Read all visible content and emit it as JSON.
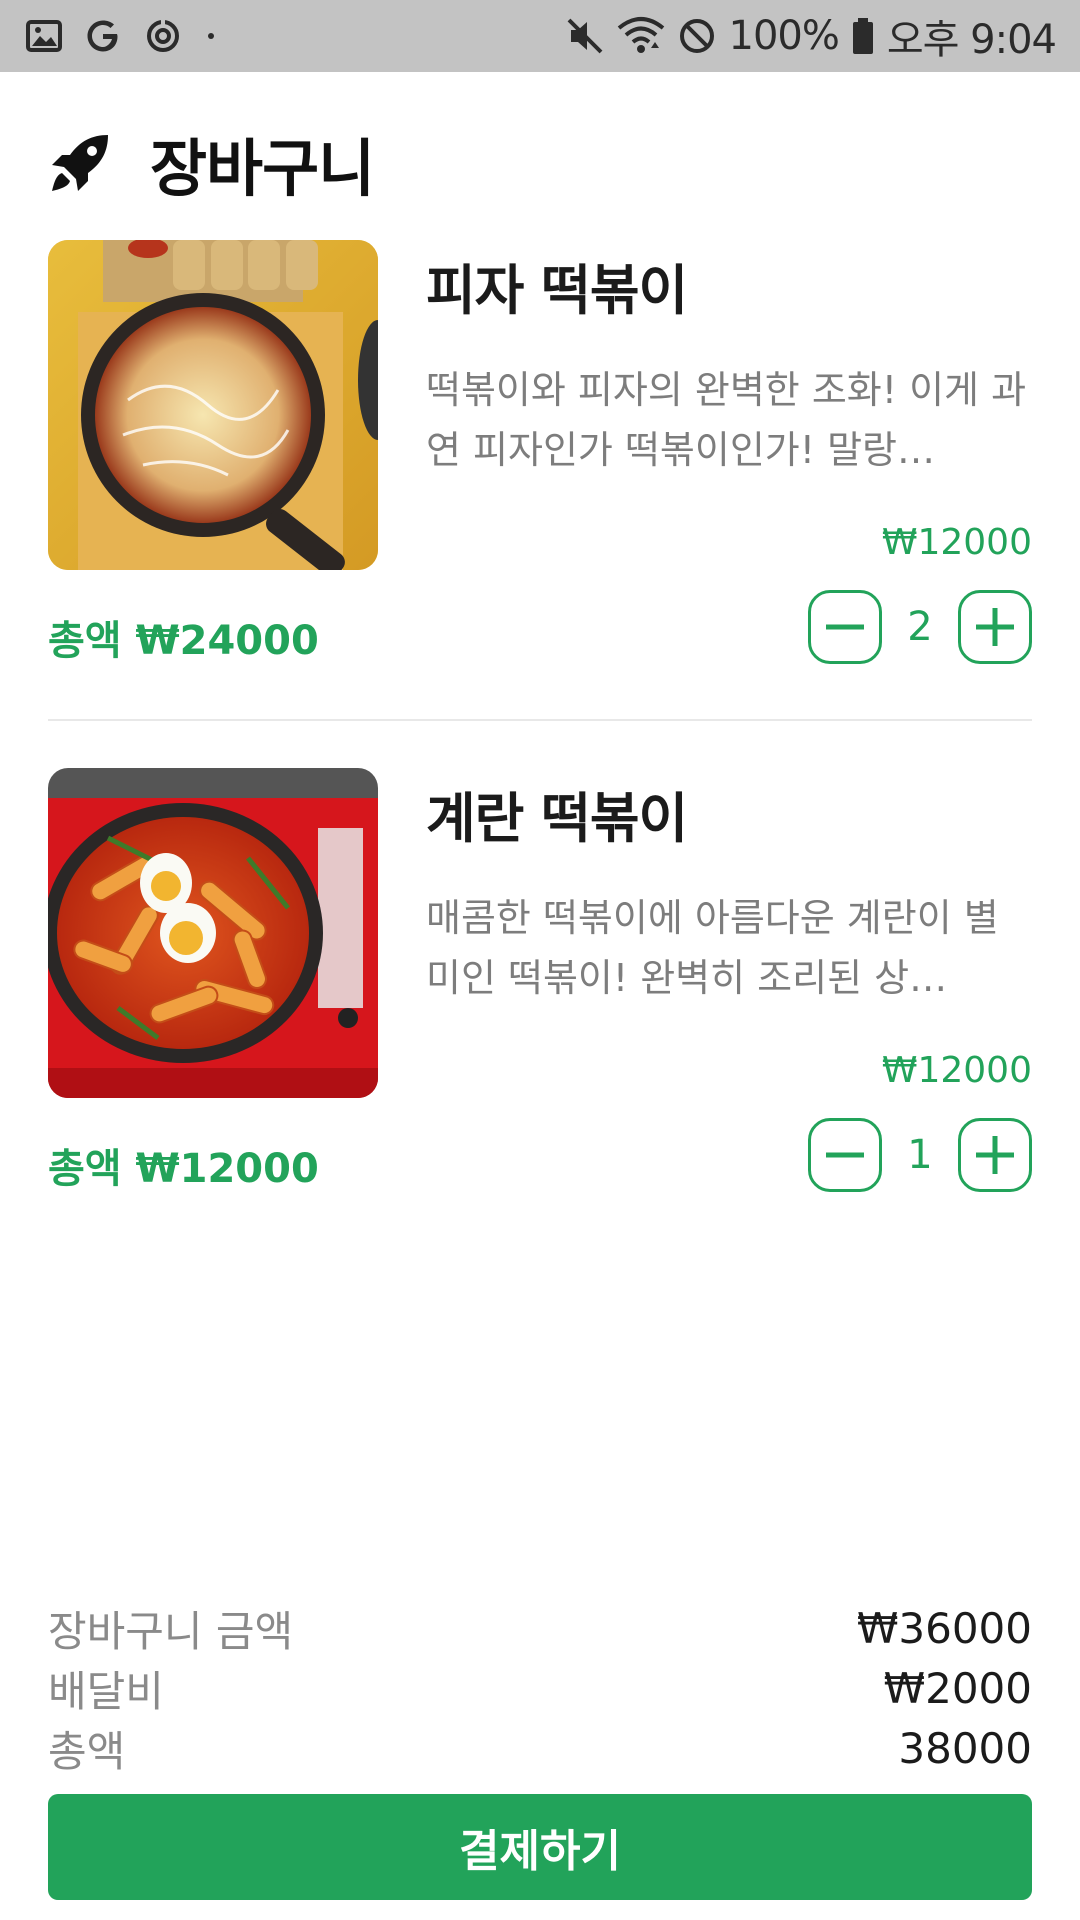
{
  "status_bar": {
    "battery": "100%",
    "time": "오후 9:04",
    "icons": [
      "gallery-icon",
      "google-icon",
      "sync-icon",
      "notification-dot-icon",
      "mute-icon",
      "wifi-icon",
      "do-not-disturb-icon",
      "battery-icon"
    ]
  },
  "header": {
    "icon": "rocket-icon",
    "title": "장바구니"
  },
  "cart": {
    "items": [
      {
        "name": "피자 떡볶이",
        "description": "떡볶이와 피자의 완벽한 조화! 이게 과연 피자인가 떡볶이인가! 말랑…",
        "price": "₩12000",
        "quantity": "2",
        "total": "총액 ₩24000",
        "image": "pizza-tteokbokki-photo"
      },
      {
        "name": "계란 떡볶이",
        "description": "매콤한 떡볶이에 아름다운 계란이 별미인 떡볶이! 완벽히 조리된 상…",
        "price": "₩12000",
        "quantity": "1",
        "total": "총액 ₩12000",
        "image": "egg-tteokbokki-photo"
      }
    ]
  },
  "summary": {
    "subtotal_label": "장바구니 금액",
    "subtotal_value": "₩36000",
    "delivery_label": "배달비",
    "delivery_value": "₩2000",
    "total_label": "총액",
    "total_value": "38000"
  },
  "checkout": {
    "button_label": "결제하기"
  },
  "colors": {
    "accent": "#22a35a",
    "status_bar": "#c3c3c3",
    "muted_text": "#7d7d7d"
  }
}
